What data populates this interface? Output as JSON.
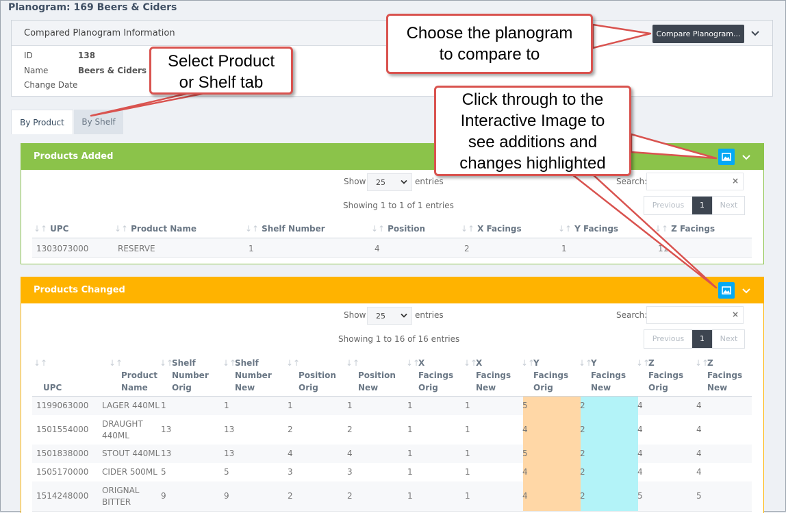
{
  "page": {
    "title": "Planogram: 169 Beers & Ciders"
  },
  "compared_panel": {
    "title": "Compared Planogram Information",
    "compare_button": "Compare Planogram...",
    "fields": [
      {
        "label": "ID",
        "value": "138"
      },
      {
        "label": "Name",
        "value": "Beers & Ciders"
      },
      {
        "label": "Change Date",
        "value": ""
      }
    ]
  },
  "tabs": [
    {
      "label": "By Product",
      "active": true
    },
    {
      "label": "By Shelf",
      "active": false
    }
  ],
  "products_added": {
    "title": "Products Added",
    "show_label": "Show",
    "page_size": "25",
    "entries_label": "entries",
    "search_label": "Search:",
    "search_clear": "×",
    "info": "Showing 1 to 1 of 1 entries",
    "pager": {
      "previous": "Previous",
      "page": "1",
      "next": "Next"
    },
    "sort_glyph": "↓↑",
    "columns": [
      "UPC",
      "Product Name",
      "Shelf Number",
      "Position",
      "X Facings",
      "Y Facings",
      "Z Facings"
    ],
    "rows": [
      [
        "1303073000",
        "RESERVE",
        "1",
        "4",
        "2",
        "1",
        "11"
      ]
    ]
  },
  "products_changed": {
    "title": "Products Changed",
    "show_label": "Show",
    "page_size": "25",
    "entries_label": "entries",
    "search_label": "Search:",
    "search_clear": "×",
    "info": "Showing 1 to 16 of 16 entries",
    "pager": {
      "previous": "Previous",
      "page": "1",
      "next": "Next"
    },
    "sort_glyph": "↓↑",
    "columns": [
      [
        "UPC"
      ],
      [
        "Product",
        "Name"
      ],
      [
        "Shelf",
        "Number",
        "Orig"
      ],
      [
        "Shelf",
        "Number",
        "New"
      ],
      [
        "Position",
        "Orig"
      ],
      [
        "Position",
        "New"
      ],
      [
        "X",
        "Facings",
        "Orig"
      ],
      [
        "X",
        "Facings",
        "New"
      ],
      [
        "Y",
        "Facings",
        "Orig"
      ],
      [
        "Y",
        "Facings",
        "New"
      ],
      [
        "Z",
        "Facings",
        "Orig"
      ],
      [
        "Z",
        "Facings",
        "New"
      ]
    ],
    "rows": [
      {
        "upc": "1199063000",
        "name": [
          "LAGER 440ML"
        ],
        "cells": [
          "1",
          "1",
          "1",
          "1",
          "1",
          "1",
          "5",
          "2",
          "4",
          "4"
        ]
      },
      {
        "upc": "1501554000",
        "name": [
          "DRAUGHT",
          "440ML"
        ],
        "cells": [
          "13",
          "13",
          "2",
          "2",
          "1",
          "1",
          "4",
          "2",
          "4",
          "4"
        ]
      },
      {
        "upc": "1501838000",
        "name": [
          "STOUT 440ML"
        ],
        "cells": [
          "13",
          "13",
          "4",
          "4",
          "1",
          "1",
          "5",
          "2",
          "4",
          "4"
        ]
      },
      {
        "upc": "1505170000",
        "name": [
          "CIDER 500ML"
        ],
        "cells": [
          "5",
          "5",
          "3",
          "3",
          "1",
          "1",
          "4",
          "2",
          "4",
          "4"
        ]
      },
      {
        "upc": "1514248000",
        "name": [
          "ORIGNAL",
          "BITTER"
        ],
        "cells": [
          "9",
          "9",
          "2",
          "2",
          "1",
          "1",
          "4",
          "2",
          "5",
          "5"
        ]
      }
    ],
    "highlight_colors": {
      "orig": "#ffd7a6",
      "new": "#b3f3f8"
    }
  },
  "callouts": [
    {
      "lines": [
        "Select Product",
        "or Shelf tab"
      ]
    },
    {
      "lines": [
        "Choose the planogram",
        "to compare to"
      ]
    },
    {
      "lines": [
        "Click through to the",
        "Interactive Image to",
        "see additions and",
        "changes highlighted"
      ]
    }
  ],
  "colors": {
    "added": "#8bc34a",
    "changed": "#ffb300",
    "image_button": "#03a9f4",
    "callout_border": "#d9534f"
  }
}
